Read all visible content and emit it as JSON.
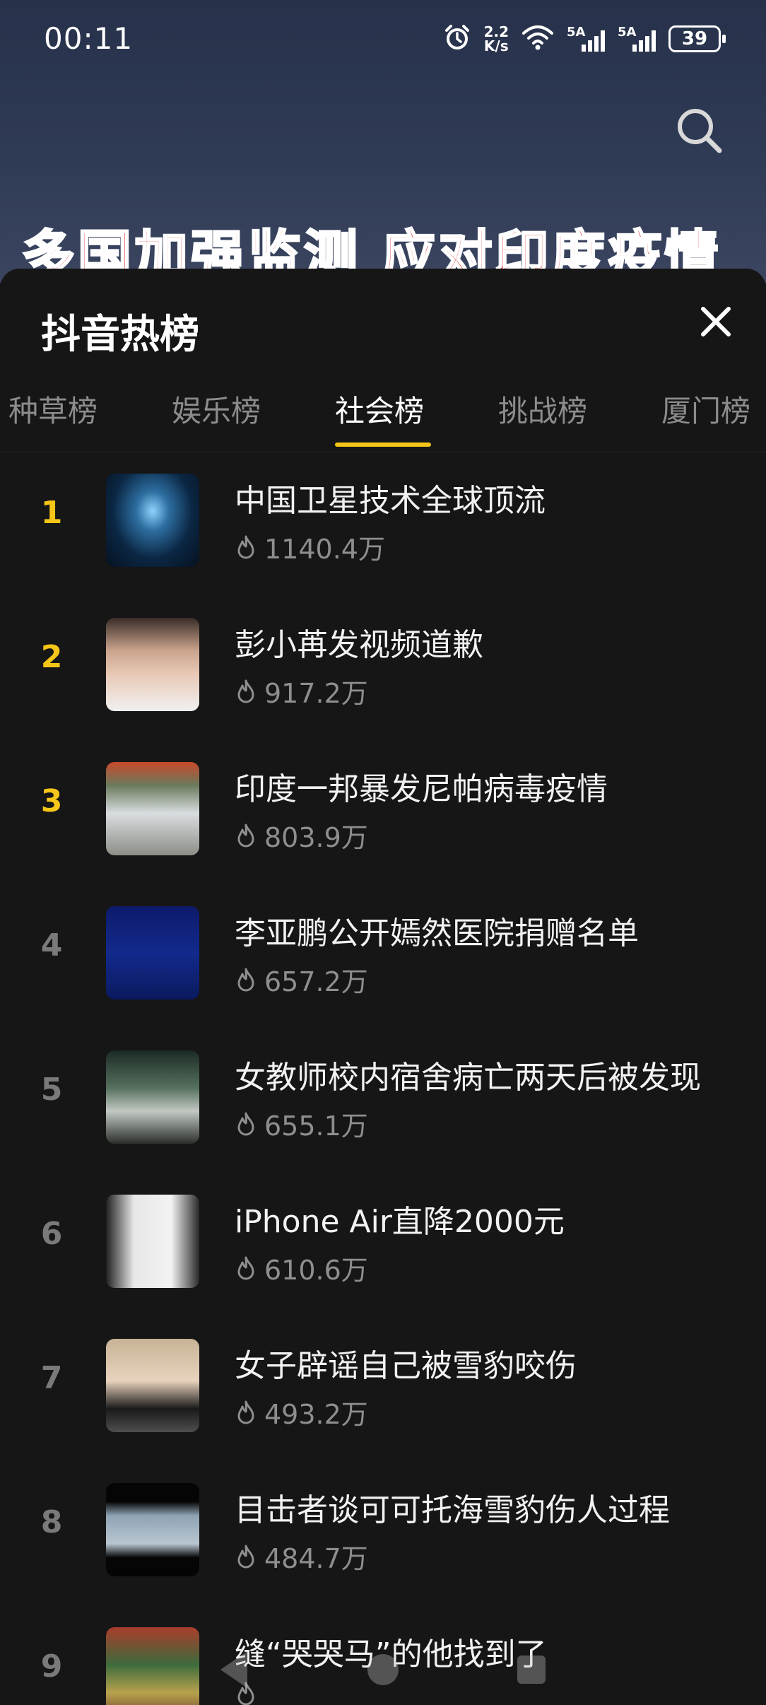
{
  "status_bar": {
    "time": "00:11",
    "net_speed_value": "2.2",
    "net_speed_unit": "K/s",
    "signal1_tag": "5A",
    "signal2_tag": "5A",
    "battery": "39"
  },
  "background": {
    "caption": "多国加强监测 应对印度疫情"
  },
  "panel": {
    "title": "抖音热榜",
    "tabs": [
      {
        "label": "种草榜"
      },
      {
        "label": "娱乐榜"
      },
      {
        "label": "社会榜"
      },
      {
        "label": "挑战榜"
      },
      {
        "label": "厦门榜"
      }
    ],
    "active_tab": "社会榜"
  },
  "list": [
    {
      "rank": "1",
      "title": "中国卫星技术全球顶流",
      "heat": "1140.4万"
    },
    {
      "rank": "2",
      "title": "彭小苒发视频道歉",
      "heat": "917.2万"
    },
    {
      "rank": "3",
      "title": "印度一邦暴发尼帕病毒疫情",
      "heat": "803.9万"
    },
    {
      "rank": "4",
      "title": "李亚鹏公开嫣然医院捐赠名单",
      "heat": "657.2万"
    },
    {
      "rank": "5",
      "title": "女教师校内宿舍病亡两天后被发现",
      "heat": "655.1万"
    },
    {
      "rank": "6",
      "title": "iPhone Air直降2000元",
      "heat": "610.6万"
    },
    {
      "rank": "7",
      "title": "女子辟谣自己被雪豹咬伤",
      "heat": "493.2万"
    },
    {
      "rank": "8",
      "title": "目击者谈可可托海雪豹伤人过程",
      "heat": "484.7万"
    },
    {
      "rank": "9",
      "title": "缝“哭哭马”的他找到了",
      "heat": ""
    }
  ],
  "colors": {
    "accent": "#f5c518",
    "background": "#161616",
    "muted_text": "#8e8e8e"
  },
  "icons": [
    "alarm-icon",
    "wifi-icon",
    "signal-icon",
    "battery-icon",
    "search-icon",
    "close-icon",
    "flame-icon"
  ]
}
